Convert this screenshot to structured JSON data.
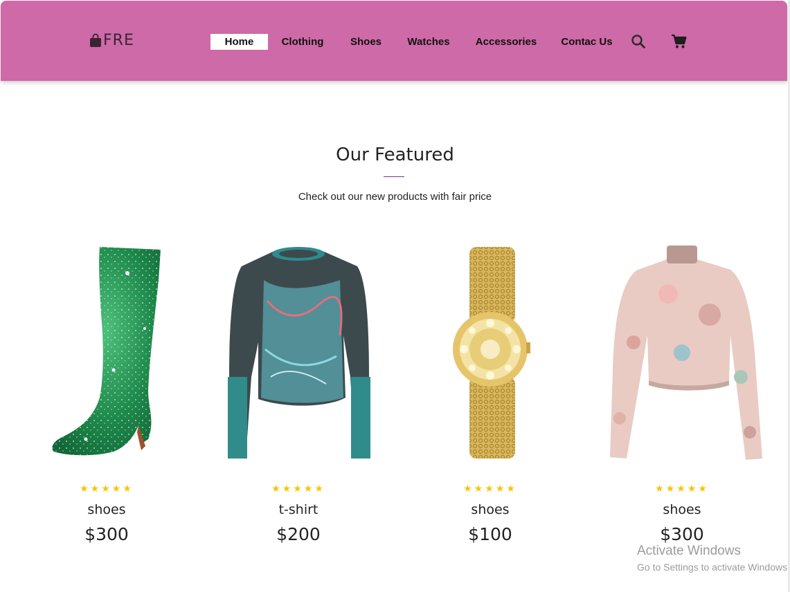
{
  "header": {
    "logo_text": "FRE",
    "logo_icon": "shopping-bag-icon",
    "bg_color": "#cd6aa7",
    "nav": [
      {
        "label": "Home",
        "active": true
      },
      {
        "label": "Clothing",
        "active": false
      },
      {
        "label": "Shoes",
        "active": false
      },
      {
        "label": "Watches",
        "active": false
      },
      {
        "label": "Accessories",
        "active": false
      },
      {
        "label": "Contac Us",
        "active": false
      }
    ],
    "icons": [
      "search-icon",
      "cart-icon"
    ]
  },
  "featured": {
    "title": "Our Featured",
    "subtitle": "Check out our new products with fair price"
  },
  "products": [
    {
      "image": "green glitter knee-high boot",
      "stars": "★★★★★",
      "name": "shoes",
      "price": "$300"
    },
    {
      "image": "mesh long-sleeve top",
      "stars": "★★★★★",
      "name": "t-shirt",
      "price": "$200"
    },
    {
      "image": "gold chain watch",
      "stars": "★★★★★",
      "name": "shoes",
      "price": "$100"
    },
    {
      "image": "pink printed crop top",
      "stars": "★★★★★",
      "name": "shoes",
      "price": "$300"
    }
  ],
  "star_color": "#f7c600",
  "watermark": {
    "line1": "Activate Windows",
    "line2": "Go to Settings to activate Windows."
  }
}
